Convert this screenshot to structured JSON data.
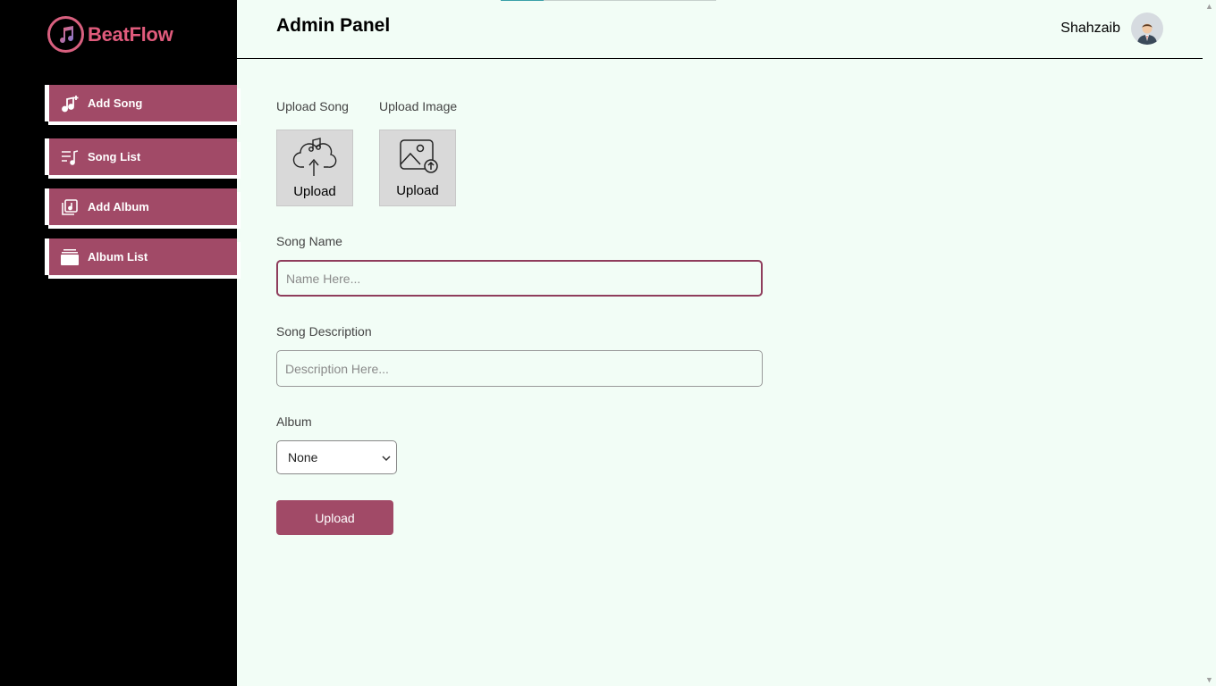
{
  "brand": {
    "name": "BeatFlow",
    "color": "#e05b7c"
  },
  "sidebar": {
    "items": [
      {
        "label": "Add Song",
        "icon": "music-note-plus-icon"
      },
      {
        "label": "Song List",
        "icon": "playlist-music-icon"
      },
      {
        "label": "Add Album",
        "icon": "album-add-icon"
      },
      {
        "label": "Album List",
        "icon": "album-stack-icon"
      }
    ],
    "accent": "#a14a67"
  },
  "header": {
    "title": "Admin Panel",
    "user_name": "Shahzaib"
  },
  "form": {
    "upload_song_label": "Upload Song",
    "upload_image_label": "Upload Image",
    "upload_song_text": "Upload",
    "upload_image_text": "Upload",
    "song_name_label": "Song Name",
    "song_name_placeholder": "Name Here...",
    "song_name_value": "",
    "song_desc_label": "Song Description",
    "song_desc_placeholder": "Description Here...",
    "song_desc_value": "",
    "album_label": "Album",
    "album_selected": "None",
    "submit_label": "Upload"
  }
}
